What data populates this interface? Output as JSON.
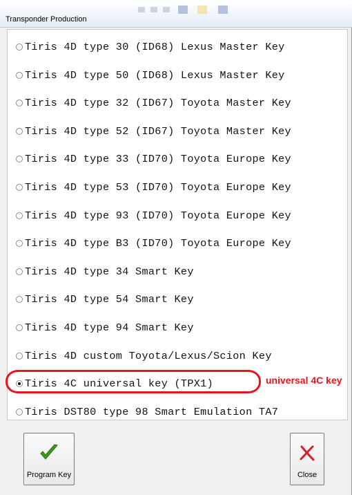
{
  "window": {
    "title": "Transponder Production"
  },
  "options": [
    {
      "label": "Tiris 4D type 30 (ID68) Lexus Master Key",
      "selected": false
    },
    {
      "label": "Tiris 4D type 50 (ID68) Lexus Master Key",
      "selected": false
    },
    {
      "label": "Tiris 4D type 32 (ID67) Toyota Master Key",
      "selected": false
    },
    {
      "label": "Tiris 4D type 52 (ID67) Toyota Master Key",
      "selected": false
    },
    {
      "label": "Tiris 4D type 33 (ID70) Toyota Europe Key",
      "selected": false
    },
    {
      "label": "Tiris 4D type 53 (ID70) Toyota Europe Key",
      "selected": false
    },
    {
      "label": "Tiris 4D type 93 (ID70) Toyota Europe Key",
      "selected": false
    },
    {
      "label": "Tiris 4D type B3 (ID70) Toyota Europe Key",
      "selected": false
    },
    {
      "label": "Tiris 4D type 34 Smart Key",
      "selected": false
    },
    {
      "label": "Tiris 4D type 54 Smart Key",
      "selected": false
    },
    {
      "label": "Tiris 4D type 94 Smart Key",
      "selected": false
    },
    {
      "label": "Tiris 4D custom Toyota/Lexus/Scion Key",
      "selected": false
    },
    {
      "label": "Tiris 4C universal key (TPX1)",
      "selected": true
    },
    {
      "label": "Tiris DST80 type 98 Smart Emulation TA7",
      "selected": false
    }
  ],
  "annotation": {
    "text": "universal 4C key",
    "color": "#e8141b"
  },
  "buttons": {
    "program_label": "Program Key",
    "program_icon": "checkmark-icon",
    "close_label": "Close",
    "close_icon": "x-close-icon"
  },
  "colors": {
    "check_green": "#3a9a1e",
    "close_red": "#d4202a"
  }
}
